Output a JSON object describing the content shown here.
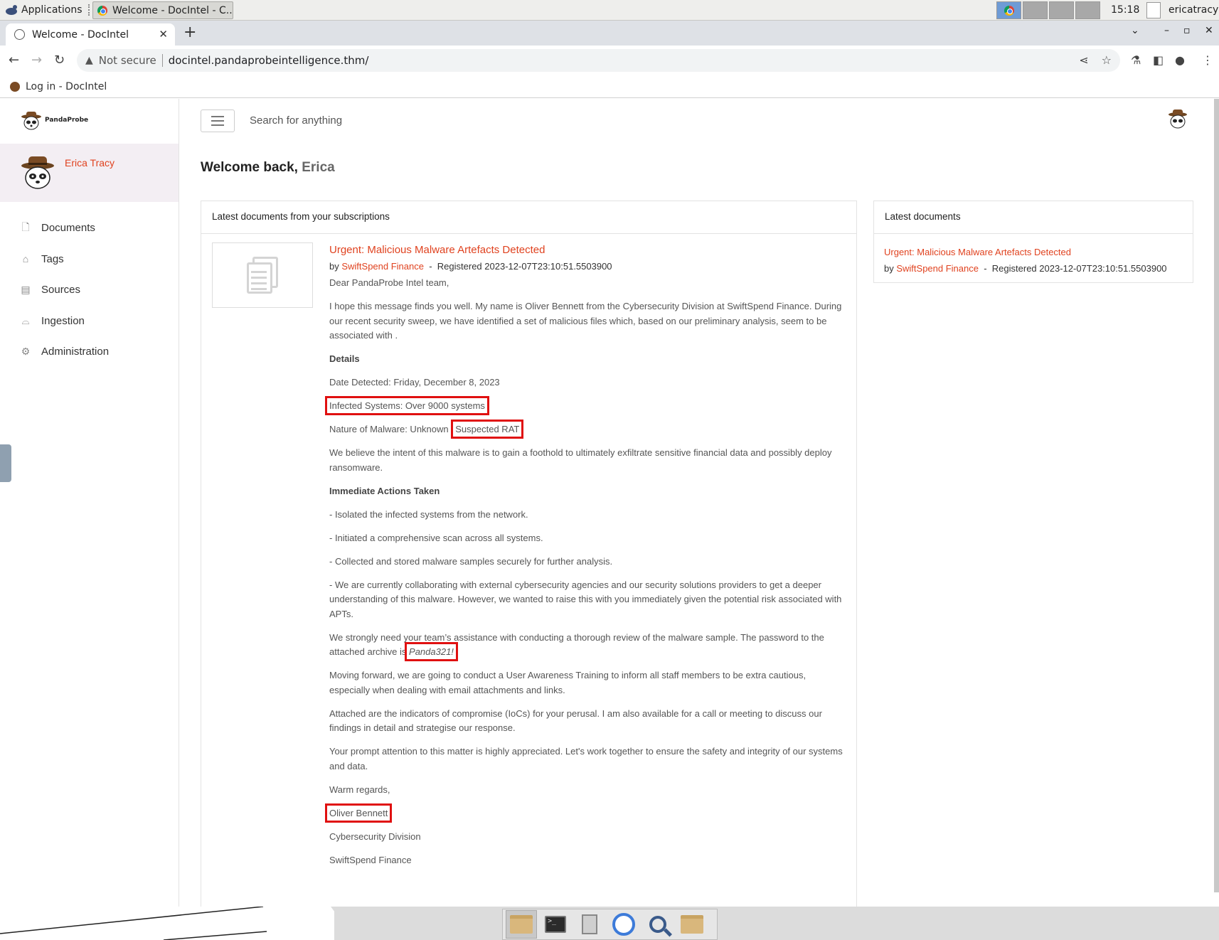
{
  "os": {
    "applications_label": "Applications",
    "task_title": "Welcome - DocIntel - C...",
    "clock": "15:18",
    "user": "ericatracy"
  },
  "browser": {
    "tab_title": "Welcome - DocIntel",
    "not_secure": "Not secure",
    "url": "docintel.pandaprobeintelligence.thm/",
    "bookmark": "Log in - DocIntel"
  },
  "app": {
    "brand": "PandaProbe",
    "user_name": "Erica Tracy",
    "search_placeholder": "Search for anything",
    "welcome_prefix": "Welcome back,",
    "welcome_name": "Erica",
    "menu": [
      {
        "label": "Documents",
        "icon": "document-icon"
      },
      {
        "label": "Tags",
        "icon": "tag-icon"
      },
      {
        "label": "Sources",
        "icon": "book-icon"
      },
      {
        "label": "Ingestion",
        "icon": "inbox-icon"
      },
      {
        "label": "Administration",
        "icon": "gear-icon"
      }
    ]
  },
  "subscriptions": {
    "heading": "Latest documents from your subscriptions",
    "doc": {
      "title": "Urgent: Malicious Malware Artefacts Detected",
      "by": "by",
      "source": "SwiftSpend Finance",
      "registered": "Registered 2023-12-07T23:10:51.5503900",
      "greeting": "Dear PandaProbe Intel team,",
      "intro": "I hope this message finds you well. My name is Oliver Bennett from the Cybersecurity Division at SwiftSpend Finance. During our recent security sweep, we have identified a set of malicious files which, based on our preliminary analysis, seem to be associated with .",
      "details_heading": "Details",
      "date_detected": "Date Detected: Friday, December 8, 2023",
      "infected_systems": "Infected Systems: Over 9000 systems",
      "nature_prefix": "Nature of Malware: Unknown",
      "nature_highlight": "Suspected RAT",
      "intent": "We believe the intent of this malware is to gain a foothold to ultimately exfiltrate sensitive financial data and possibly deploy ransomware.",
      "actions_heading": "Immediate Actions Taken",
      "action1": "- Isolated the infected systems from the network.",
      "action2": "- Initiated a comprehensive scan across all systems.",
      "action3": "- Collected and stored malware samples securely for further analysis.",
      "action4": "- We are currently collaborating with external cybersecurity agencies and our security solutions providers to get a deeper understanding of this malware. However, we wanted to raise this with you immediately given the potential risk associated with APTs.",
      "password_text": "We strongly need your team’s assistance with conducting a thorough review of the malware sample. The password to the attached archive is",
      "password": "Panda321!",
      "training": "Moving forward, we are going to conduct a User Awareness Training to inform all staff members to be extra cautious, especially when dealing with email attachments and links.",
      "iocs": "Attached are the indicators of compromise (IoCs) for your perusal. I am also available for a call or meeting to discuss our findings in detail and strategise our response.",
      "closing": "Your prompt attention to this matter is highly appreciated. Let's work together to ensure the safety and integrity of our systems and data.",
      "regards": "Warm regards,",
      "signature": "Oliver Bennett",
      "division": "Cybersecurity Division",
      "company": "SwiftSpend Finance"
    }
  },
  "latest": {
    "heading": "Latest documents",
    "title": "Urgent: Malicious Malware Artefacts Detected",
    "by": "by",
    "source": "SwiftSpend Finance",
    "registered": "Registered 2023-12-07T23:10:51.5503900"
  },
  "colors": {
    "accent": "#e0421f",
    "highlight_box": "#e01010",
    "sidebar_user_bg": "#f3eef3"
  }
}
